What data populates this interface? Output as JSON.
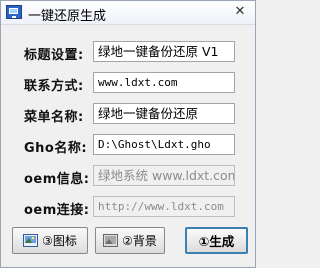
{
  "window": {
    "title": "一键还原生成",
    "close_glyph": "✕"
  },
  "form": {
    "rows": [
      {
        "label": "标题设置:",
        "value": "绿地一键备份还原 V1",
        "enabled": true
      },
      {
        "label": "联系方式:",
        "value": "www.ldxt.com",
        "enabled": true
      },
      {
        "label": "菜单名称:",
        "value": "绿地一键备份还原",
        "enabled": true
      },
      {
        "label": "Gho名称:",
        "value": "D:\\Ghost\\Ldxt.gho",
        "enabled": true
      },
      {
        "label": "oem信息:",
        "value": "绿地系统 www.ldxt.com",
        "enabled": false
      },
      {
        "label": "oem连接:",
        "value": "http://www.ldxt.com",
        "enabled": false
      }
    ]
  },
  "buttons": {
    "icon_label": "③图标",
    "bg_label": "②背景",
    "generate_label": "①生成"
  },
  "colors": {
    "accent": "#3c7fb1",
    "disabled_text": "#8c8c8c"
  }
}
